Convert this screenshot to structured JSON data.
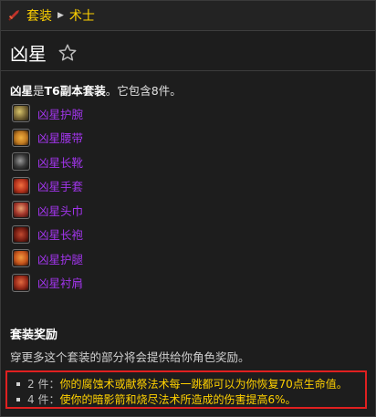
{
  "breadcrumb": {
    "icon": "dagger-icon",
    "items": [
      "套装",
      "术士"
    ]
  },
  "page": {
    "title": "凶星",
    "favorite_icon": "star-outline-icon"
  },
  "description": {
    "name": "凶星",
    "middle": "是",
    "tier": "T6副本套装",
    "tail": "。它包含8件。"
  },
  "items": [
    {
      "name": "凶星护腕",
      "icon_color": "#6b5a2e"
    },
    {
      "name": "凶星腰带",
      "icon_color": "#c07a22"
    },
    {
      "name": "凶星长靴",
      "icon_color": "#3a3a3a"
    },
    {
      "name": "凶星手套",
      "icon_color": "#b5321c"
    },
    {
      "name": "凶星头巾",
      "icon_color": "#a0342a"
    },
    {
      "name": "凶星长袍",
      "icon_color": "#7a1f14"
    },
    {
      "name": "凶星护腿",
      "icon_color": "#c6551c"
    },
    {
      "name": "凶星衬肩",
      "icon_color": "#9b2b1a"
    }
  ],
  "set_bonus": {
    "heading": "套装奖励",
    "subtitle": "穿更多这个套装的部分将会提供给你角色奖励。",
    "bonuses": [
      {
        "count": "2 件：",
        "text": "你的腐蚀术或献祭法术每一跳都可以为你恢复70点生命值。"
      },
      {
        "count": "4 件：",
        "text": "使你的暗影箭和烧尽法术所造成的伤害提高6%。"
      }
    ]
  },
  "colors": {
    "gold": "#ffd100",
    "epic": "#a335ee",
    "highlight_border": "#e02020"
  }
}
